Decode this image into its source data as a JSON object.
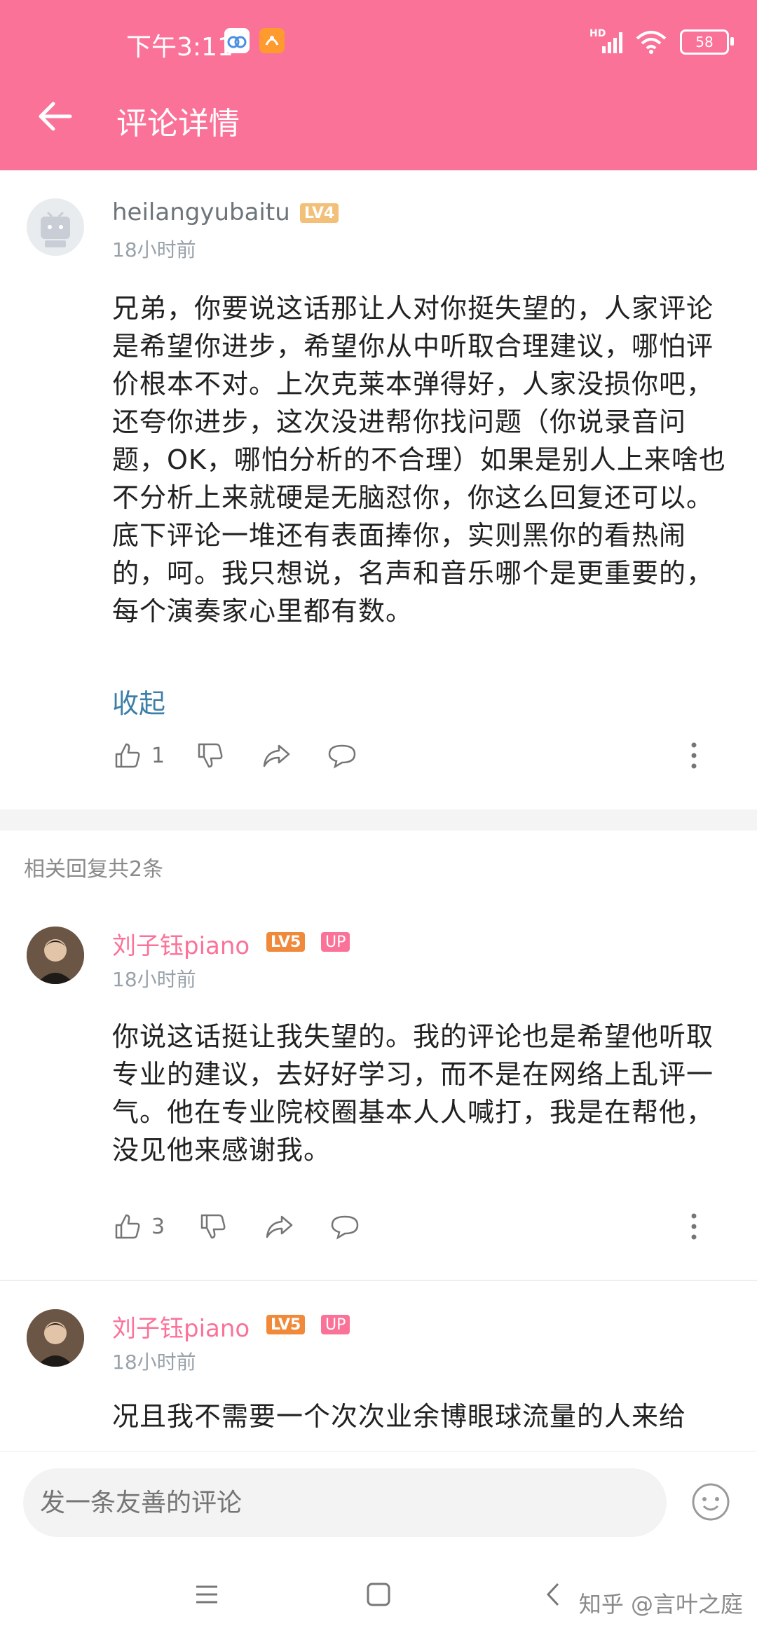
{
  "status_bar": {
    "time": "下午3:11",
    "battery": "58",
    "network": "HD"
  },
  "header": {
    "title": "评论详情"
  },
  "main_comment": {
    "username": "heilangyubaitu",
    "level": "LV4",
    "time": "18小时前",
    "text": "兄弟，你要说这话那让人对你挺失望的，人家评论是希望你进步，希望你从中听取合理建议，哪怕评价根本不对。上次克莱本弹得好，人家没损你吧，还夸你进步，这次没进帮你找问题（你说录音问题，OK，哪怕分析的不合理）如果是别人上来啥也不分析上来就硬是无脑怼你，你这么回复还可以。底下评论一堆还有表面捧你，实则黑你的看热闹的，呵。我只想说，名声和音乐哪个是更重要的，每个演奏家心里都有数。",
    "collapse": "收起",
    "likes": "1"
  },
  "related_label": "相关回复共2条",
  "replies": [
    {
      "username": "刘子钰piano",
      "level": "LV5",
      "badge": "UP",
      "time": "18小时前",
      "text": "你说这话挺让我失望的。我的评论也是希望他听取专业的建议，去好好学习，而不是在网络上乱评一气。他在专业院校圈基本人人喊打，我是在帮他，没见他来感谢我。",
      "likes": "3"
    },
    {
      "username": "刘子钰piano",
      "level": "LV5",
      "badge": "UP",
      "time": "18小时前",
      "text": "况且我不需要一个次次业余博眼球流量的人来给"
    }
  ],
  "input": {
    "placeholder": "发一条友善的评论"
  },
  "watermark": "知乎 @言叶之庭",
  "colors": {
    "brand": "#fb7299",
    "link": "#3d7fa8",
    "lv4": "#f3c07a",
    "lv5": "#f08a3a"
  }
}
